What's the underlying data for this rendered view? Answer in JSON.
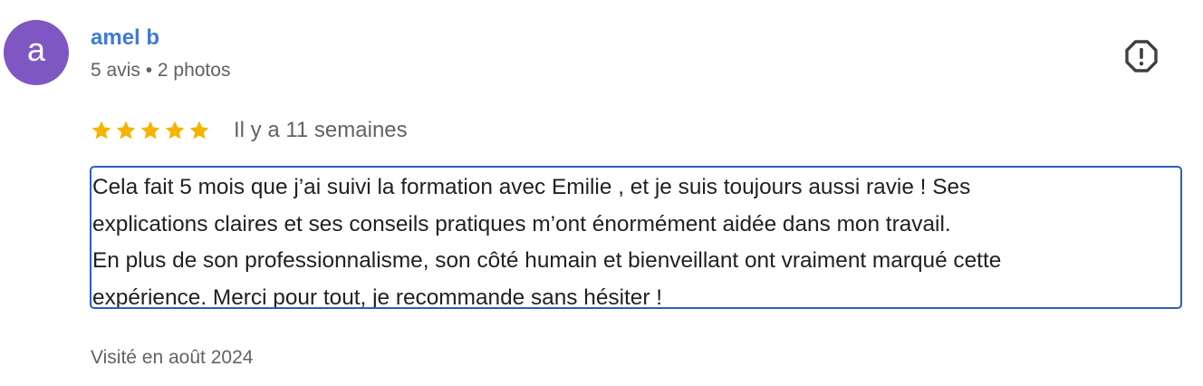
{
  "review": {
    "avatar_letter": "a",
    "author": {
      "name": "amel b",
      "meta": "5 avis • 2 photos"
    },
    "rating": {
      "stars": 5,
      "max": 5,
      "color": "#f4b400"
    },
    "date": "Il y a 11 semaines",
    "text_lines": [
      "Cela fait 5 mois que j’ai suivi la formation avec Emilie , et je suis toujours aussi ravie ! Ses",
      "explications claires et ses conseils pratiques m’ont énormément aidée dans mon travail.",
      "En plus de son professionnalisme, son côté humain et bienveillant ont vraiment marqué cette",
      "expérience. Merci pour tout, je recommande sans hésiter !"
    ],
    "visit": "Visité en août 2024",
    "icons": {
      "report": "report-icon",
      "star": "star-icon"
    },
    "colors": {
      "avatar_bg": "#7e57c2",
      "author_link": "#3f7ad6",
      "focus_border": "#2b5fb8",
      "secondary_text": "#5f6368"
    }
  }
}
